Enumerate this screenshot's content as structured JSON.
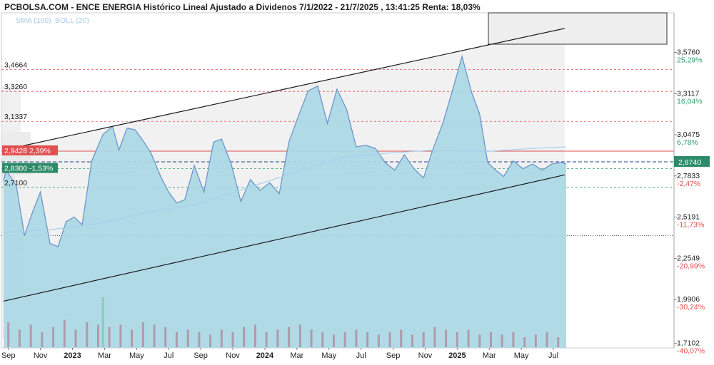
{
  "title": "PCBOLSA.COM - ENCE ENERGIA Histórico Lineal Ajustado a Dividenos 7/1/2022 - 21/7/2025 , 13:41:25 Renta: 18,03%",
  "legend": {
    "sma": "SMA (100)",
    "boll": "BOLL (20)"
  },
  "colors": {
    "area_fill": "#add8e6",
    "area_line": "#6c96c8",
    "sma": "#a7d0ee",
    "channel": "#1a1a1a",
    "resistance": "#e05050",
    "current": "#1e3f8a",
    "support": "#2e9a6a",
    "volume": "#b08a9a",
    "volume_spike": "#7fc8b0",
    "pct_green": "#2e9a6a",
    "pct_red": "#e05050",
    "badge_green": "#2e8b6a",
    "badge_red": "#e05050"
  },
  "left_levels": [
    {
      "value": "3,4664",
      "y": 3.4664,
      "style": "red-dash"
    },
    {
      "value": "3,3260",
      "y": 3.326,
      "style": "red-dash"
    },
    {
      "value": "3,1337",
      "y": 3.1337,
      "style": "red-dash"
    },
    {
      "value": "2,7100",
      "y": 2.71,
      "style": "green-dash"
    }
  ],
  "badges": [
    {
      "text": "2,9428  2,39%",
      "y": 2.9428,
      "color": "red"
    },
    {
      "text": "2,8300  -1,53%",
      "y": 2.83,
      "color": "green"
    }
  ],
  "right_axis": [
    {
      "value": "3,5760",
      "pct": "25,29%",
      "y": 3.576,
      "sign": "pos"
    },
    {
      "value": "3,3117",
      "pct": "16,04%",
      "y": 3.3117,
      "sign": "pos"
    },
    {
      "value": "3,0475",
      "pct": "6,78%",
      "y": 3.0475,
      "sign": "pos"
    },
    {
      "value": "2,7833",
      "pct": "-2,47%",
      "y": 2.7833,
      "sign": "neg"
    },
    {
      "value": "2,5191",
      "pct": "-11,73%",
      "y": 2.5191,
      "sign": "neg"
    },
    {
      "value": "2,2549",
      "pct": "-20,99%",
      "y": 2.2549,
      "sign": "neg"
    },
    {
      "value": "1,9906",
      "pct": "-30,24%",
      "y": 1.9906,
      "sign": "neg"
    },
    {
      "value": "1,7102",
      "pct": "-40,07%",
      "y": 1.7102,
      "sign": "neg"
    }
  ],
  "current_price": {
    "text": "2,8740",
    "y": 2.874
  },
  "x_labels": [
    {
      "label": "Sep",
      "t": 0.3,
      "bold": false
    },
    {
      "label": "Nov",
      "t": 2.3,
      "bold": false
    },
    {
      "label": "2023",
      "t": 4.3,
      "bold": true
    },
    {
      "label": "Mar",
      "t": 6.3,
      "bold": false
    },
    {
      "label": "May",
      "t": 8.3,
      "bold": false
    },
    {
      "label": "Jul",
      "t": 10.3,
      "bold": false
    },
    {
      "label": "Sep",
      "t": 12.3,
      "bold": false
    },
    {
      "label": "Nov",
      "t": 14.3,
      "bold": false
    },
    {
      "label": "2024",
      "t": 16.3,
      "bold": true
    },
    {
      "label": "Mar",
      "t": 18.3,
      "bold": false
    },
    {
      "label": "May",
      "t": 20.3,
      "bold": false
    },
    {
      "label": "Jul",
      "t": 22.3,
      "bold": false
    },
    {
      "label": "Sep",
      "t": 24.3,
      "bold": false
    },
    {
      "label": "Nov",
      "t": 26.3,
      "bold": false
    },
    {
      "label": "2025",
      "t": 28.3,
      "bold": true
    },
    {
      "label": "Mar",
      "t": 30.3,
      "bold": false
    },
    {
      "label": "May",
      "t": 32.3,
      "bold": false
    },
    {
      "label": "Jul",
      "t": 34.3,
      "bold": false
    }
  ],
  "chart_data": {
    "type": "area",
    "x_unit": "months since Sep 2022",
    "y_unit": "EUR",
    "ylim": [
      1.68,
      3.83
    ],
    "xlim": [
      0,
      35.1
    ],
    "series": [
      {
        "name": "",
        "x": [
          0,
          0.15,
          0.8,
          1.3,
          1.8,
          2.3,
          2.9,
          3.4,
          3.9,
          4.4,
          4.9,
          5.5,
          6.2,
          6.8,
          7.2,
          7.7,
          8.2,
          8.7,
          9.2,
          9.8,
          10.3,
          10.8,
          11.3,
          11.9,
          12.5,
          13.1,
          13.6,
          14.2,
          14.8,
          15.4,
          16.0,
          16.6,
          17.2,
          17.8,
          18.4,
          19.0,
          19.6,
          20.2,
          20.8,
          21.4,
          22.0,
          22.6,
          23.2,
          23.8,
          24.4,
          25.0,
          25.6,
          26.2,
          26.8,
          27.4,
          28.0,
          28.6,
          29.2,
          29.7,
          30.2,
          30.7,
          31.2,
          31.8,
          32.4,
          33.0,
          33.6,
          34.2,
          34.8,
          35.1
        ],
        "values": [
          2.75,
          2.82,
          2.72,
          2.4,
          2.55,
          2.68,
          2.35,
          2.33,
          2.49,
          2.52,
          2.47,
          2.88,
          3.05,
          3.1,
          2.95,
          3.09,
          3.08,
          3.01,
          2.93,
          2.78,
          2.68,
          2.61,
          2.63,
          2.85,
          2.68,
          3.0,
          3.02,
          2.86,
          2.62,
          2.76,
          2.69,
          2.74,
          2.67,
          3.0,
          3.17,
          3.33,
          3.36,
          3.12,
          3.34,
          3.21,
          2.97,
          2.98,
          2.96,
          2.87,
          2.82,
          2.92,
          2.83,
          2.77,
          2.96,
          3.12,
          3.33,
          3.55,
          3.32,
          3.18,
          2.87,
          2.82,
          2.78,
          2.88,
          2.83,
          2.86,
          2.82,
          2.86,
          2.87,
          2.86
        ]
      },
      {
        "name": "SMA (100)",
        "x": [
          0,
          3,
          6,
          9,
          12,
          15,
          18,
          21,
          24,
          27,
          30,
          33,
          35.1
        ],
        "values": [
          2.42,
          2.44,
          2.48,
          2.55,
          2.6,
          2.7,
          2.8,
          2.9,
          2.93,
          2.95,
          2.94,
          2.96,
          2.97
        ]
      }
    ],
    "channel_lines": [
      {
        "x": [
          0,
          35
        ],
        "values": [
          1.98,
          2.79
        ]
      },
      {
        "x": [
          0,
          35
        ],
        "values": [
          2.95,
          3.73
        ]
      }
    ],
    "volume": {
      "x": [
        0.3,
        1.0,
        1.7,
        2.4,
        3.1,
        3.8,
        4.5,
        5.2,
        5.9,
        6.2,
        6.6,
        7.3,
        8.0,
        8.7,
        9.4,
        10.1,
        10.8,
        11.5,
        12.2,
        12.9,
        13.6,
        14.3,
        15.0,
        15.7,
        16.4,
        17.1,
        17.8,
        18.5,
        19.2,
        19.9,
        20.6,
        21.3,
        22.0,
        22.7,
        23.4,
        24.1,
        24.8,
        25.5,
        26.2,
        26.9,
        27.6,
        28.3,
        29.0,
        29.7,
        30.4,
        31.1,
        31.8,
        32.5,
        33.2,
        33.9,
        34.6
      ],
      "values": [
        0.5,
        0.35,
        0.45,
        0.3,
        0.4,
        0.55,
        0.35,
        0.5,
        0.45,
        1.0,
        0.4,
        0.45,
        0.35,
        0.5,
        0.45,
        0.4,
        0.3,
        0.35,
        0.3,
        0.25,
        0.35,
        0.3,
        0.4,
        0.45,
        0.3,
        0.35,
        0.4,
        0.45,
        0.35,
        0.3,
        0.25,
        0.3,
        0.35,
        0.3,
        0.25,
        0.3,
        0.35,
        0.25,
        0.3,
        0.4,
        0.35,
        0.3,
        0.35,
        0.25,
        0.3,
        0.25,
        0.3,
        0.2,
        0.25,
        0.3,
        0.2
      ]
    },
    "grid": false,
    "legend_position": "top-left"
  }
}
